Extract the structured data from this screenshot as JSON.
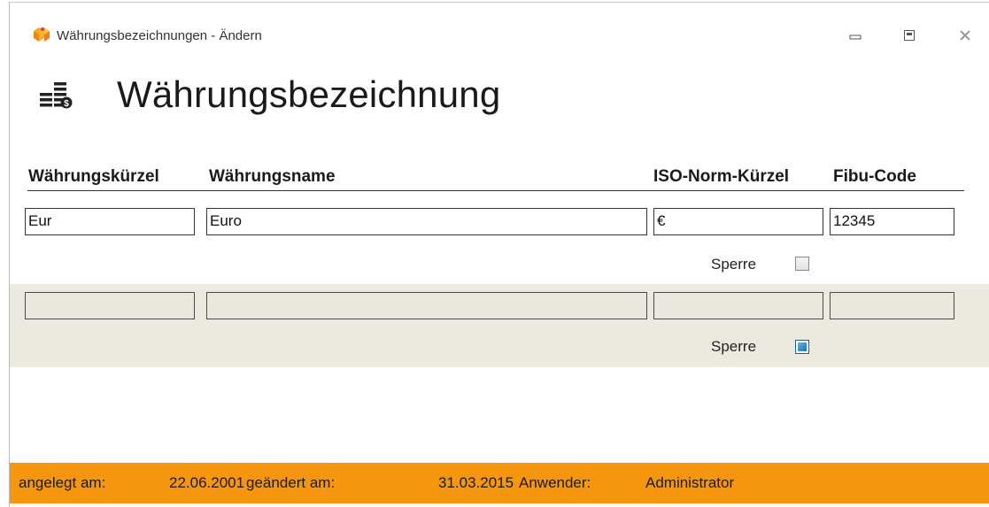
{
  "window": {
    "title": "Währungsbezeichnungen - Ändern"
  },
  "page": {
    "title": "Währungsbezeichnung",
    "icon": "currency-list-icon"
  },
  "table": {
    "columns": [
      "Währungskürzel",
      "Währungsname",
      "ISO-Norm-Kürzel",
      "Fibu-Code"
    ],
    "rows": [
      {
        "code": "Eur",
        "name": "Euro",
        "iso": "€",
        "fibu": "12345",
        "lock_label": "Sperre",
        "locked": false
      },
      {
        "code": "",
        "name": "",
        "iso": "",
        "fibu": "",
        "lock_label": "Sperre",
        "locked": true
      }
    ]
  },
  "footer": {
    "created_label": "angelegt am:",
    "created_value": "22.06.2001",
    "modified_label": "geändert am:",
    "modified_value": "31.03.2015",
    "user_label": "Anwender:",
    "user_value": "Administrator"
  },
  "colors": {
    "footer_bg": "#f5960e",
    "row_band_bg": "#eceae0",
    "checkbox_checked": "#1a6db3"
  }
}
